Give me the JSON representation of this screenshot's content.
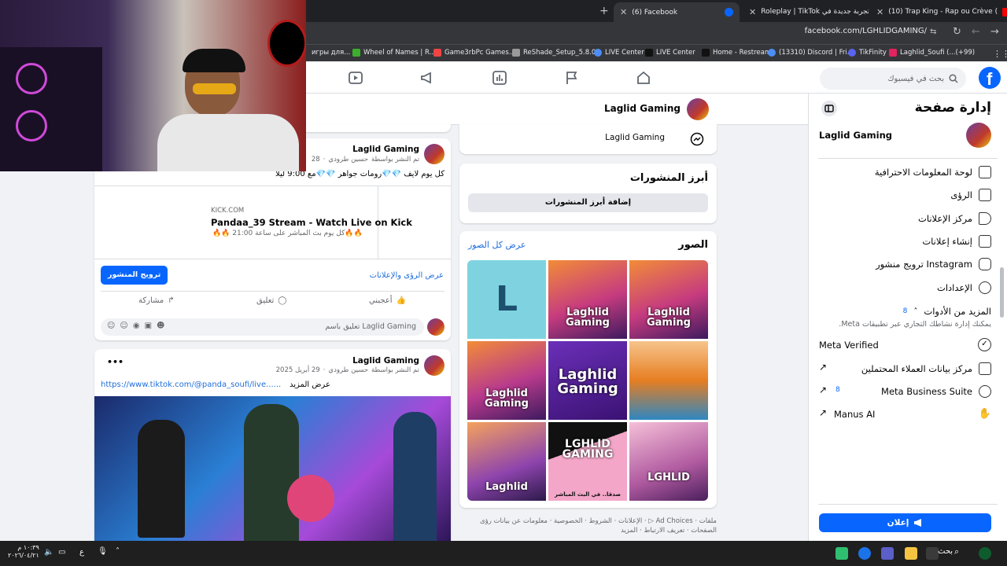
{
  "browser": {
    "tabs": [
      {
        "title": "(10) Trap King - Rap ou Crève (",
        "favicon": "youtube-icon"
      },
      {
        "title": "تجربة جديدة في Roleplay | TikTok",
        "favicon": "tiktok-icon"
      },
      {
        "title": "(6) Facebook",
        "favicon": "facebook-icon",
        "active": true
      }
    ],
    "new_tab": "+",
    "url": "facebook.com/LGHLIDGAMING/",
    "bookmarks": [
      "игры для...",
      "Wheel of Names | R...",
      "Game3rbPc Games...",
      "ReShade_Setup_5.8.0",
      "LIVE Center",
      "LIVE Center",
      "Home - Restream",
      "(13310) Discord | Fri...",
      "TikFinity",
      "Laghlid_Soufi (...(+99)"
    ]
  },
  "colors": {
    "fb_blue": "#0866ff",
    "link": "#216fdb",
    "panel_bg": "#ffffff",
    "feed_bg": "#f0f2f5"
  },
  "fb": {
    "search_placeholder": "بحث في فيسبوك",
    "page_name": "Laglid Gaming"
  },
  "manage": {
    "title": "إدارة صفحة",
    "page_name": "Laglid Gaming",
    "items": [
      {
        "label": "لوحة المعلومات الاحترافية",
        "icon": "dashboard-icon"
      },
      {
        "label": "الرؤى",
        "icon": "insights-icon"
      },
      {
        "label": "مركز الإعلانات",
        "icon": "megaphone-icon"
      },
      {
        "label": "إنشاء إعلانات",
        "icon": "edit-icon"
      },
      {
        "label": "ترويج منشور Instagram",
        "icon": "instagram-icon"
      },
      {
        "label": "الإعدادات",
        "icon": "gear-icon"
      }
    ],
    "more_tools": "المزيد من الأدوات",
    "more_tools_sub": "يمكنك إدارة نشاطك التجاري عبر تطبيقات Meta.",
    "more_tools_badge": "8",
    "meta_verified": "Meta Verified",
    "leads": "مركز بيانات العملاء المحتملين",
    "business_suite": "Meta Business Suite",
    "business_suite_badge": "8",
    "manus": "Manus AI",
    "ad_button": "إعلان"
  },
  "middle": {
    "messenger_label": "Laglid Gaming",
    "featured_title": "أبرز المنشورات",
    "featured_button": "إضافة أبرز المنشورات",
    "photos_title": "الصور",
    "photos_link": "عرض كل الصور",
    "photos": [
      {
        "text": "L",
        "style": "letter"
      },
      {
        "text": "Laghlid Gaming",
        "style": "art"
      },
      {
        "text": "Laghlid Gaming",
        "style": "art"
      },
      {
        "text": "Laghlid Gaming",
        "style": "art"
      },
      {
        "text": "Laghlid Gaming",
        "style": "purple"
      },
      {
        "text": "",
        "style": "gta"
      },
      {
        "text": "Laghlid",
        "style": "art"
      },
      {
        "text": "LGHLID GAMING",
        "style": "pink",
        "sub": "صدقا.. في البث المباشر"
      },
      {
        "text": "LGHLID",
        "style": "art"
      }
    ],
    "footer": "ملفات · Ad Choices ▷ · الإعلانات · الشروط · الخصوصية · معلومات عن بيانات رؤى الصفحات · تعريف الارتباط · المزيد"
  },
  "feed": {
    "post1": {
      "author": "Laglid Gaming",
      "meta_prefix": "تم النشر بواسطة",
      "meta_name": "حسين طرودي",
      "meta_date": "28",
      "text": "كل يوم لايف 💎💎رومات جواهر 💎💎مع 9:00 ليلا",
      "link_domain": "KICK.COM",
      "link_title": "Pandaa_39 Stream - Watch Live on Kick",
      "link_desc": "🔥🔥كل يوم بث المباشر على ساعة 21:00 🔥🔥",
      "insights": "عرض الرؤى والإعلانات",
      "boost": "ترويج المنشور",
      "like": "أعجبني",
      "comment": "تعليق",
      "share": "مشاركة",
      "comment_placeholder": "تعليق باسم Laglid Gaming"
    },
    "post2": {
      "author": "Laglid Gaming",
      "meta_prefix": "تم النشر بواسطة",
      "meta_name": "حسين طرودي",
      "meta_date": "29 أبريل 2025",
      "link": "https://www.tiktok.com/@panda_soufi/live......",
      "see_more": "عرض المزيد"
    }
  },
  "taskbar": {
    "time": "١٠:٣٩ م",
    "date": "٢٠٢٦/٠٤/٢١",
    "lang": "ع",
    "search": "بحث"
  }
}
